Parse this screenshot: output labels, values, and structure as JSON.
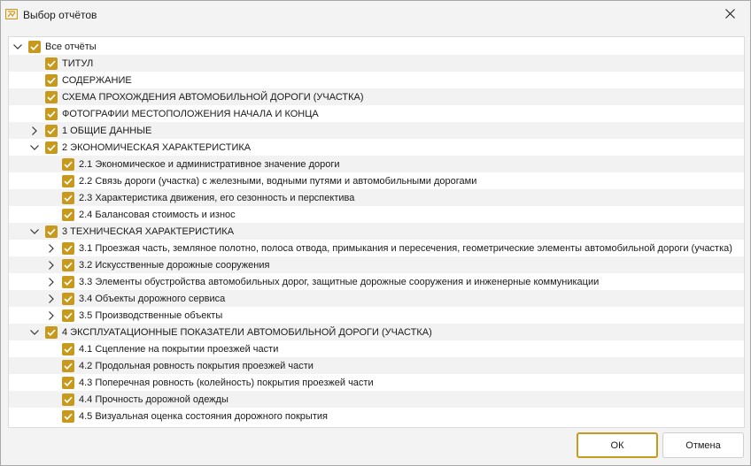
{
  "window": {
    "title": "Выбор отчётов"
  },
  "colors": {
    "accent": "#c79a1e"
  },
  "tree": {
    "items": [
      {
        "label": "Все отчёты",
        "level": 0,
        "expander": "down",
        "checked": true
      },
      {
        "label": "ТИТУЛ",
        "level": 1,
        "expander": "none",
        "checked": true
      },
      {
        "label": "СОДЕРЖАНИЕ",
        "level": 1,
        "expander": "none",
        "checked": true
      },
      {
        "label": "СХЕМА ПРОХОЖДЕНИЯ АВТОМОБИЛЬНОЙ ДОРОГИ (УЧАСТКА)",
        "level": 1,
        "expander": "none",
        "checked": true
      },
      {
        "label": "ФОТОГРАФИИ МЕСТОПОЛОЖЕНИЯ НАЧАЛА И КОНЦА",
        "level": 1,
        "expander": "none",
        "checked": true
      },
      {
        "label": "1 ОБЩИЕ ДАННЫЕ",
        "level": 1,
        "expander": "right",
        "checked": true
      },
      {
        "label": "2 ЭКОНОМИЧЕСКАЯ ХАРАКТЕРИСТИКА",
        "level": 1,
        "expander": "down",
        "checked": true
      },
      {
        "label": "2.1 Экономическое и административное значение дороги",
        "level": 2,
        "expander": "none",
        "checked": true
      },
      {
        "label": "2.2 Связь дороги (участка) с железными, водными путями и автомобильными дорогами",
        "level": 2,
        "expander": "none",
        "checked": true
      },
      {
        "label": "2.3 Характеристика движения, его сезонность и перспектива",
        "level": 2,
        "expander": "none",
        "checked": true
      },
      {
        "label": "2.4 Балансовая стоимость и износ",
        "level": 2,
        "expander": "none",
        "checked": true
      },
      {
        "label": "3 ТЕХНИЧЕСКАЯ ХАРАКТЕРИСТИКА",
        "level": 1,
        "expander": "down",
        "checked": true
      },
      {
        "label": "3.1 Проезжая часть, земляное полотно, полоса отвода, примыкания и пересечения, геометрические элементы автомобильной дороги (участка)",
        "level": 2,
        "expander": "right",
        "checked": true
      },
      {
        "label": "3.2 Искусственные дорожные сооружения",
        "level": 2,
        "expander": "right",
        "checked": true
      },
      {
        "label": "3.3 Элементы обустройства автомобильных дорог, защитные дорожные сооружения и инженерные коммуникации",
        "level": 2,
        "expander": "right",
        "checked": true
      },
      {
        "label": "3.4 Объекты дорожного сервиса",
        "level": 2,
        "expander": "right",
        "checked": true
      },
      {
        "label": "3.5 Производственные объекты",
        "level": 2,
        "expander": "right",
        "checked": true
      },
      {
        "label": "4 ЭКСПЛУАТАЦИОННЫЕ ПОКАЗАТЕЛИ АВТОМОБИЛЬНОЙ ДОРОГИ (УЧАСТКА)",
        "level": 1,
        "expander": "down",
        "checked": true
      },
      {
        "label": "4.1 Сцепление на покрытии проезжей части",
        "level": 2,
        "expander": "none",
        "checked": true
      },
      {
        "label": "4.2 Продольная ровность покрытия проезжей части",
        "level": 2,
        "expander": "none",
        "checked": true
      },
      {
        "label": "4.3 Поперечная ровность (колейность) покрытия проезжей части",
        "level": 2,
        "expander": "none",
        "checked": true
      },
      {
        "label": "4.4 Прочность дорожной одежды",
        "level": 2,
        "expander": "none",
        "checked": true
      },
      {
        "label": "4.5 Визуальная оценка состояния дорожного покрытия",
        "level": 2,
        "expander": "none",
        "checked": true
      }
    ]
  },
  "footer": {
    "ok_label": "ОК",
    "cancel_label": "Отмена"
  }
}
